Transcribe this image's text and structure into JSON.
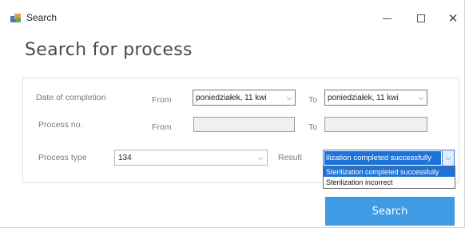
{
  "window": {
    "title": "Search",
    "minimize_glyph": "—",
    "maximize_glyph": "☐",
    "close_glyph": "✕"
  },
  "page": {
    "title": "Search for process"
  },
  "date_row": {
    "label": "Date of completion",
    "from_label": "From",
    "from_value": "poniedziałek, 11   kwi",
    "to_label": "To",
    "to_value": "poniedziałek, 11   kwi"
  },
  "process_row": {
    "label": "Process no.",
    "from_label": "From",
    "from_value": "",
    "to_label": "To",
    "to_value": ""
  },
  "type_row": {
    "label": "Process type",
    "value": "134",
    "result_label": "Result",
    "result_value": "ilization completed successfully",
    "result_options": [
      "Sterilization completed successfully",
      "Sterilization incorrect"
    ],
    "highlighted_option": 0
  },
  "actions": {
    "search_label": "Search"
  },
  "colors": {
    "accent": "#3f9be3",
    "selection": "#1e73d8"
  },
  "icons": {
    "app": "search-app-icon",
    "caret": "chevron-down-icon"
  }
}
